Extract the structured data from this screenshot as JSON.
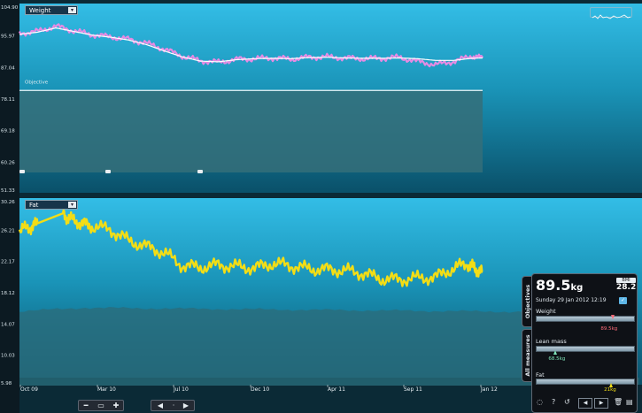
{
  "chart_data": [
    {
      "type": "line",
      "title": "Weight",
      "yticks": [
        "104.90",
        "95.97",
        "87.04",
        "78.11",
        "69.18",
        "60.26",
        "51.33"
      ],
      "ylim": [
        51.33,
        104.9
      ],
      "xticks": [
        "Oct 09",
        "Mar 10",
        "Jul 10",
        "Dec 10",
        "Apr 11",
        "Sep 11",
        "Jan 12"
      ],
      "series": [
        {
          "color": "#e58be3",
          "x": [
            0,
            5,
            10,
            15,
            20,
            25,
            30,
            35,
            40,
            45,
            50,
            55,
            60,
            65,
            70,
            75,
            80,
            85,
            90,
            95,
            100,
            105,
            110,
            115,
            120,
            125,
            128
          ],
          "y": [
            96.5,
            97.0,
            98.5,
            97.2,
            96.1,
            95.5,
            94.8,
            93.7,
            92.0,
            90.0,
            88.7,
            88.3,
            89.1,
            89.3,
            89.5,
            89.2,
            89.7,
            89.8,
            89.5,
            89.3,
            89.4,
            89.7,
            88.5,
            87.6,
            88.5,
            90.0,
            89.5
          ]
        },
        {
          "color": "#ffffff",
          "x": [
            0,
            5,
            10,
            15,
            20,
            25,
            30,
            35,
            40,
            45,
            50,
            55,
            60,
            65,
            70,
            75,
            80,
            85,
            90,
            95,
            100,
            105,
            110,
            115,
            120,
            125,
            128
          ],
          "y": [
            96.2,
            96.8,
            98.0,
            97.0,
            96.0,
            95.4,
            94.6,
            93.3,
            91.5,
            89.8,
            88.6,
            88.4,
            89.0,
            89.3,
            89.4,
            89.3,
            89.6,
            89.7,
            89.5,
            89.4,
            89.4,
            89.5,
            89.3,
            88.8,
            88.8,
            89.4,
            89.5
          ]
        }
      ],
      "objective": {
        "label": "Objective",
        "value": 80.3
      }
    },
    {
      "type": "line",
      "title": "Fat",
      "yticks": [
        "30.26",
        "26.21",
        "22.17",
        "18.12",
        "14.07",
        "10.03",
        "5.98"
      ],
      "ylim": [
        5.98,
        30.26
      ],
      "xticks": [
        "Oct 09",
        "Mar 10",
        "Jul 10",
        "Dec 10",
        "Apr 11",
        "Sep 11",
        "Jan 12"
      ],
      "series": [
        {
          "color": "#f2dd16",
          "x": [
            0,
            3,
            5,
            12,
            14,
            17,
            20,
            25,
            30,
            35,
            40,
            45,
            50,
            55,
            60,
            65,
            70,
            75,
            80,
            85,
            90,
            95,
            100,
            105,
            110,
            115,
            120,
            124,
            126,
            128
          ],
          "y": [
            26.0,
            26.5,
            27.0,
            28.3,
            27.5,
            27.0,
            26.6,
            26.2,
            24.8,
            24.0,
            23.2,
            21.5,
            21.3,
            21.6,
            21.4,
            21.2,
            21.8,
            21.5,
            21.1,
            21.0,
            20.9,
            20.5,
            19.8,
            19.7,
            19.9,
            20.0,
            21.2,
            21.8,
            21.0,
            20.7
          ]
        }
      ]
    }
  ],
  "panel": {
    "weight_big": "89.5",
    "weight_unit": "kg",
    "bmi_label": "BMI",
    "bmi_value": "28.2",
    "date": "Sunday 29 Jan 2012 12:19",
    "tab_objectives": "Objectives",
    "tab_all": "All measures",
    "measures": [
      {
        "label": "Weight",
        "value": "89.5kg",
        "color": "#ff6b78",
        "pos": 0.78
      },
      {
        "label": "Lean mass",
        "value": "68.5kg",
        "color": "#7fe3b8",
        "pos": 0.2
      },
      {
        "label": "Fat",
        "value": "21kg",
        "color": "#f2dd16",
        "pos": 0.76
      }
    ]
  },
  "icons": {
    "panel": [
      "chat-icon",
      "help-icon",
      "undo-icon",
      "prev-icon",
      "next-icon",
      "trash-icon",
      "notes-icon"
    ]
  }
}
